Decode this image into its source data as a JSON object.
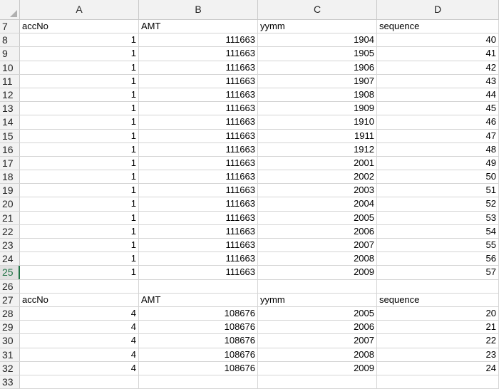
{
  "columns": [
    "A",
    "B",
    "C",
    "D"
  ],
  "rows": [
    {
      "n": "7",
      "cells": [
        "accNo",
        "AMT",
        "yymm",
        "sequence"
      ],
      "types": [
        "t",
        "t",
        "t",
        "t"
      ]
    },
    {
      "n": "8",
      "cells": [
        "1",
        "111663",
        "1904",
        "40"
      ],
      "types": [
        "n",
        "n",
        "n",
        "n"
      ]
    },
    {
      "n": "9",
      "cells": [
        "1",
        "111663",
        "1905",
        "41"
      ],
      "types": [
        "n",
        "n",
        "n",
        "n"
      ]
    },
    {
      "n": "10",
      "cells": [
        "1",
        "111663",
        "1906",
        "42"
      ],
      "types": [
        "n",
        "n",
        "n",
        "n"
      ]
    },
    {
      "n": "11",
      "cells": [
        "1",
        "111663",
        "1907",
        "43"
      ],
      "types": [
        "n",
        "n",
        "n",
        "n"
      ]
    },
    {
      "n": "12",
      "cells": [
        "1",
        "111663",
        "1908",
        "44"
      ],
      "types": [
        "n",
        "n",
        "n",
        "n"
      ]
    },
    {
      "n": "13",
      "cells": [
        "1",
        "111663",
        "1909",
        "45"
      ],
      "types": [
        "n",
        "n",
        "n",
        "n"
      ]
    },
    {
      "n": "14",
      "cells": [
        "1",
        "111663",
        "1910",
        "46"
      ],
      "types": [
        "n",
        "n",
        "n",
        "n"
      ]
    },
    {
      "n": "15",
      "cells": [
        "1",
        "111663",
        "1911",
        "47"
      ],
      "types": [
        "n",
        "n",
        "n",
        "n"
      ]
    },
    {
      "n": "16",
      "cells": [
        "1",
        "111663",
        "1912",
        "48"
      ],
      "types": [
        "n",
        "n",
        "n",
        "n"
      ]
    },
    {
      "n": "17",
      "cells": [
        "1",
        "111663",
        "2001",
        "49"
      ],
      "types": [
        "n",
        "n",
        "n",
        "n"
      ]
    },
    {
      "n": "18",
      "cells": [
        "1",
        "111663",
        "2002",
        "50"
      ],
      "types": [
        "n",
        "n",
        "n",
        "n"
      ]
    },
    {
      "n": "19",
      "cells": [
        "1",
        "111663",
        "2003",
        "51"
      ],
      "types": [
        "n",
        "n",
        "n",
        "n"
      ]
    },
    {
      "n": "20",
      "cells": [
        "1",
        "111663",
        "2004",
        "52"
      ],
      "types": [
        "n",
        "n",
        "n",
        "n"
      ]
    },
    {
      "n": "21",
      "cells": [
        "1",
        "111663",
        "2005",
        "53"
      ],
      "types": [
        "n",
        "n",
        "n",
        "n"
      ]
    },
    {
      "n": "22",
      "cells": [
        "1",
        "111663",
        "2006",
        "54"
      ],
      "types": [
        "n",
        "n",
        "n",
        "n"
      ]
    },
    {
      "n": "23",
      "cells": [
        "1",
        "111663",
        "2007",
        "55"
      ],
      "types": [
        "n",
        "n",
        "n",
        "n"
      ]
    },
    {
      "n": "24",
      "cells": [
        "1",
        "111663",
        "2008",
        "56"
      ],
      "types": [
        "n",
        "n",
        "n",
        "n"
      ]
    },
    {
      "n": "25",
      "cells": [
        "1",
        "111663",
        "2009",
        "57"
      ],
      "types": [
        "n",
        "n",
        "n",
        "n"
      ],
      "selected": true
    },
    {
      "n": "26",
      "cells": [
        "",
        "",
        "",
        ""
      ],
      "types": [
        "t",
        "t",
        "t",
        "t"
      ]
    },
    {
      "n": "27",
      "cells": [
        "accNo",
        "AMT",
        "yymm",
        "sequence"
      ],
      "types": [
        "t",
        "t",
        "t",
        "t"
      ]
    },
    {
      "n": "28",
      "cells": [
        "4",
        "108676",
        "2005",
        "20"
      ],
      "types": [
        "n",
        "n",
        "n",
        "n"
      ]
    },
    {
      "n": "29",
      "cells": [
        "4",
        "108676",
        "2006",
        "21"
      ],
      "types": [
        "n",
        "n",
        "n",
        "n"
      ]
    },
    {
      "n": "30",
      "cells": [
        "4",
        "108676",
        "2007",
        "22"
      ],
      "types": [
        "n",
        "n",
        "n",
        "n"
      ]
    },
    {
      "n": "31",
      "cells": [
        "4",
        "108676",
        "2008",
        "23"
      ],
      "types": [
        "n",
        "n",
        "n",
        "n"
      ]
    },
    {
      "n": "32",
      "cells": [
        "4",
        "108676",
        "2009",
        "24"
      ],
      "types": [
        "n",
        "n",
        "n",
        "n"
      ]
    },
    {
      "n": "33",
      "cells": [
        "",
        "",
        "",
        ""
      ],
      "types": [
        "t",
        "t",
        "t",
        "t"
      ]
    }
  ]
}
